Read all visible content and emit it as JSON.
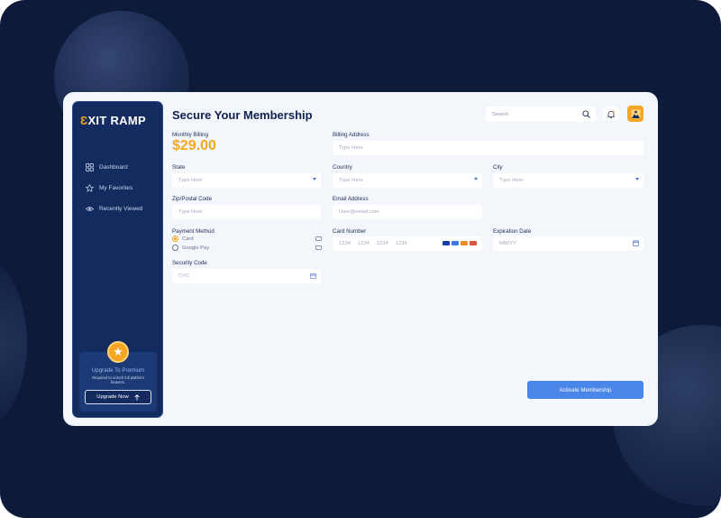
{
  "app": {
    "logo_text": "EXIT RAMP",
    "page_title": "Secure Your Membership"
  },
  "colors": {
    "accent": "#f5a623",
    "sidebar_bg": "#132b5e",
    "primary_button": "#4a86e8",
    "page_bg": "#0d1a3a"
  },
  "sidebar": {
    "items": [
      {
        "label": "Dashboard",
        "icon": "grid-icon"
      },
      {
        "label": "My Favorites",
        "icon": "star-icon"
      },
      {
        "label": "Recently Viewed",
        "icon": "eye-icon"
      }
    ],
    "upgrade": {
      "title": "Upgrade To Premium",
      "subtitle": "Required to unlock full platform features.",
      "button_label": "Upgrade Now"
    }
  },
  "header": {
    "search_placeholder": "Search"
  },
  "form": {
    "monthly_billing_label": "Monthly Billing",
    "price": "$29.00",
    "billing_address": {
      "label": "Billing Address",
      "placeholder": "Type Here"
    },
    "state": {
      "label": "State",
      "placeholder": "Type Here"
    },
    "country": {
      "label": "Country",
      "placeholder": "Type Here"
    },
    "city": {
      "label": "City",
      "placeholder": "Type Here"
    },
    "zip": {
      "label": "Zip/Postal Code",
      "placeholder": "Type Here"
    },
    "email": {
      "label": "Email Address",
      "placeholder": "User@email.com"
    },
    "payment_method": {
      "label": "Payment Method",
      "options": [
        "Card",
        "Google Pay"
      ],
      "selected": "Card"
    },
    "card_number": {
      "label": "Card Number",
      "groups": [
        "1234",
        "1234",
        "1234",
        "1234"
      ]
    },
    "expiration": {
      "label": "Expiration Date",
      "placeholder": "MM/YY"
    },
    "security_code": {
      "label": "Security Code",
      "placeholder": "CVC"
    },
    "submit_label": "Activate Membership"
  }
}
